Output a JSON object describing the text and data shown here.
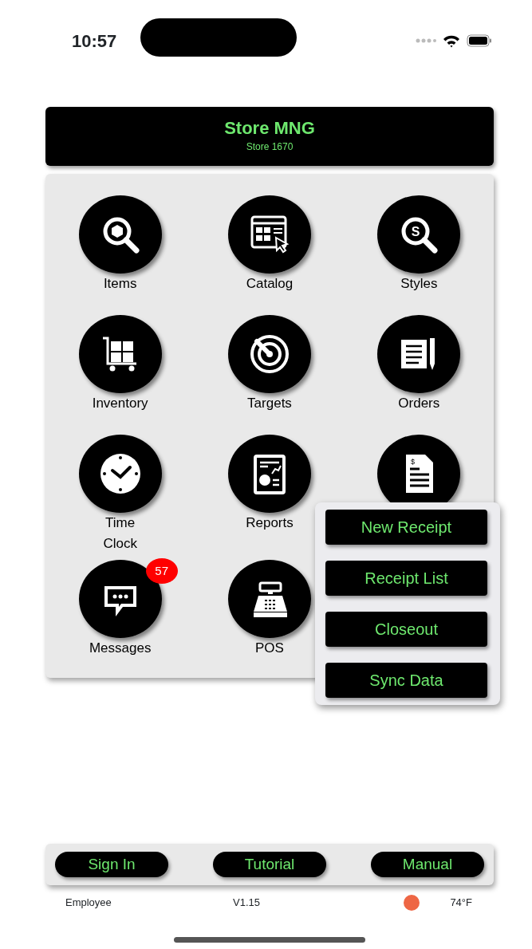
{
  "status_bar": {
    "time": "10:57"
  },
  "header": {
    "title": "Store MNG",
    "subtitle": "Store 1670"
  },
  "tiles": [
    {
      "kind": "items",
      "label": "Items"
    },
    {
      "kind": "catalog",
      "label": "Catalog"
    },
    {
      "kind": "styles",
      "label": "Styles",
      "glyph": "S"
    },
    {
      "kind": "inventory",
      "label": "Inventory"
    },
    {
      "kind": "targets",
      "label": "Targets"
    },
    {
      "kind": "orders",
      "label": "Orders"
    },
    {
      "kind": "timeclock",
      "label": "Time Clock"
    },
    {
      "kind": "reports",
      "label": "Reports"
    },
    {
      "kind": "receipt",
      "glyph": "$"
    },
    {
      "kind": "messages",
      "label": "Messages",
      "badge": "57"
    },
    {
      "kind": "pos",
      "label": "POS"
    }
  ],
  "popup_menu": [
    "New Receipt",
    "Receipt List",
    "Closeout",
    "Sync Data"
  ],
  "bottom_buttons": [
    "Sign In",
    "Tutorial",
    "Manual"
  ],
  "footer": {
    "user": "Employee",
    "version": "V1.15",
    "status_dot": {
      "color": "#ee6644"
    },
    "temperature": "74°F"
  }
}
